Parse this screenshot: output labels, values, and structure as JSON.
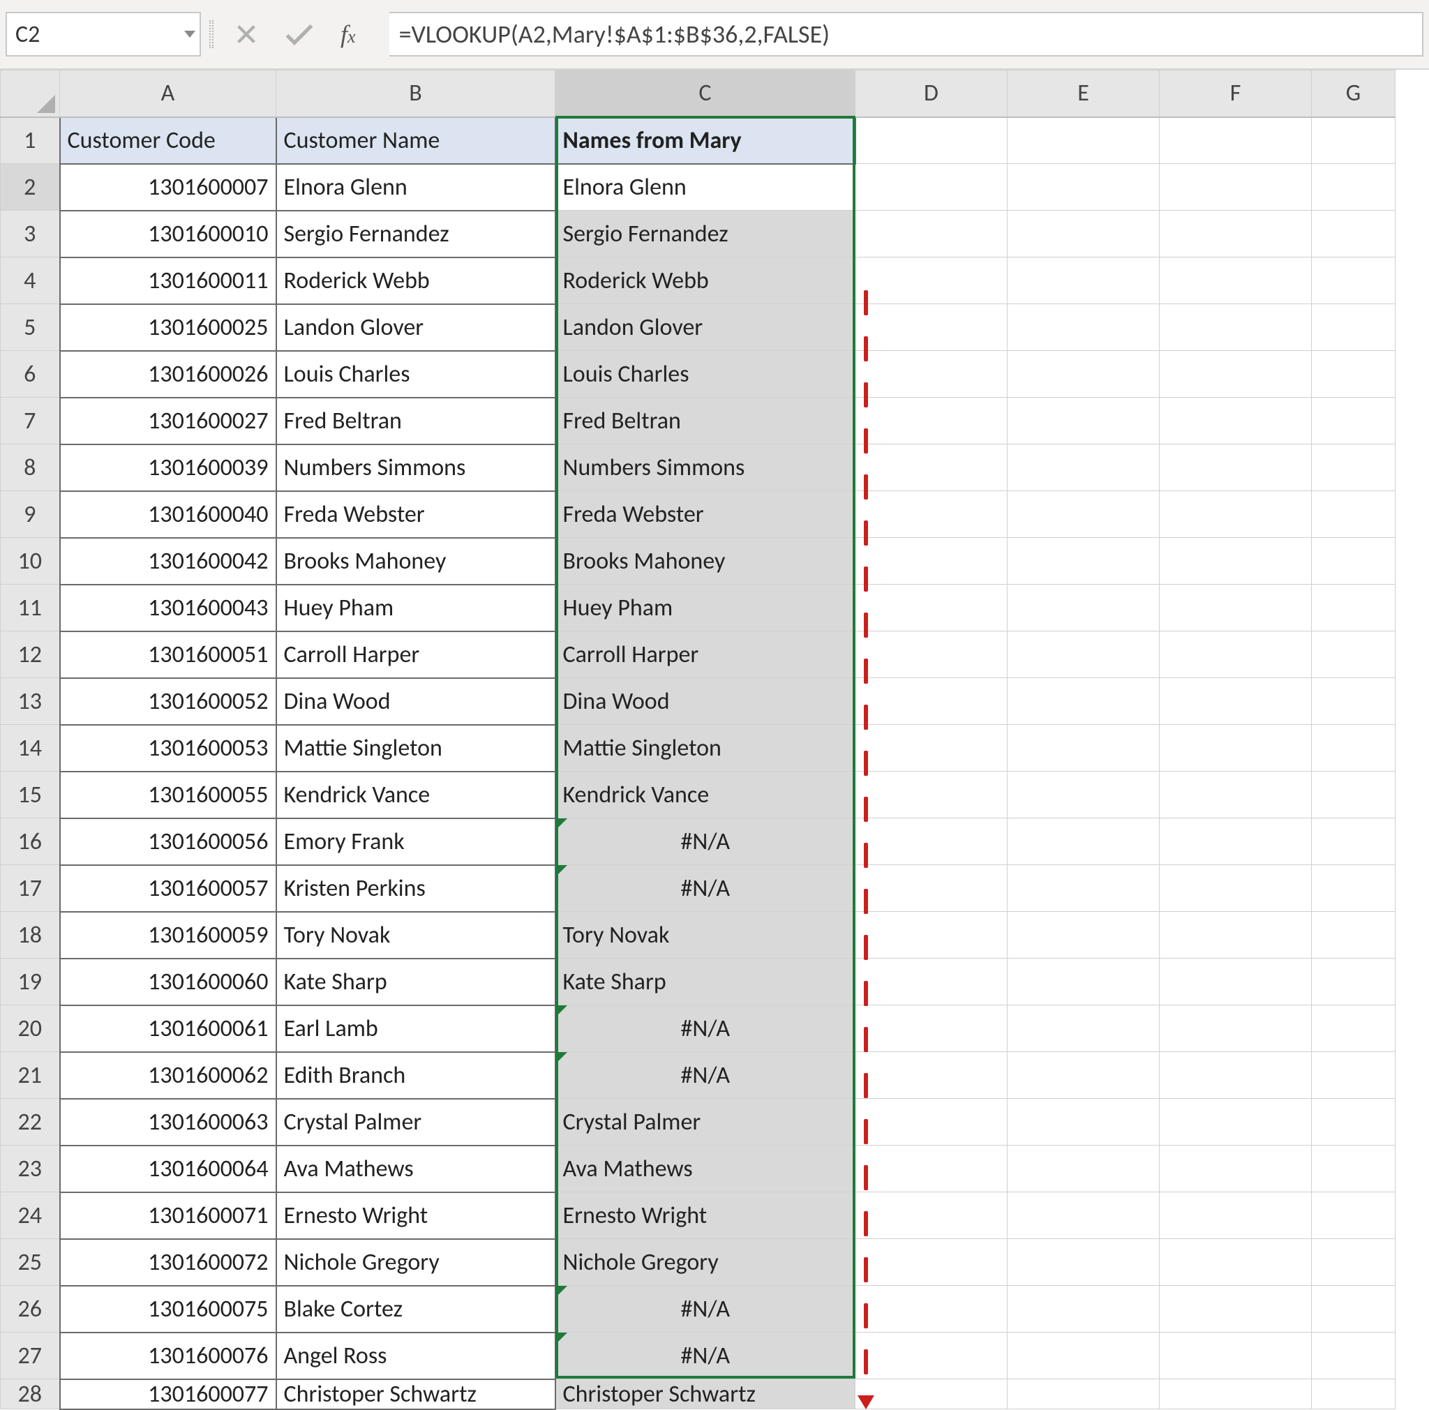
{
  "name_box": "C2",
  "formula": "=VLOOKUP(A2,Mary!$A$1:$B$36,2,FALSE)",
  "columns": [
    "A",
    "B",
    "C",
    "D",
    "E",
    "F",
    "G"
  ],
  "header_row": {
    "A": "Customer Code",
    "B": "Customer Name",
    "C": "Names from Mary"
  },
  "rows": [
    {
      "r": 2,
      "A": "1301600007",
      "B": "Elnora Glenn",
      "C": "Elnora Glenn",
      "err": false
    },
    {
      "r": 3,
      "A": "1301600010",
      "B": "Sergio Fernandez",
      "C": "Sergio Fernandez",
      "err": false
    },
    {
      "r": 4,
      "A": "1301600011",
      "B": "Roderick Webb",
      "C": "Roderick Webb",
      "err": false
    },
    {
      "r": 5,
      "A": "1301600025",
      "B": "Landon Glover",
      "C": "Landon Glover",
      "err": false
    },
    {
      "r": 6,
      "A": "1301600026",
      "B": "Louis Charles",
      "C": "Louis Charles",
      "err": false
    },
    {
      "r": 7,
      "A": "1301600027",
      "B": "Fred Beltran",
      "C": "Fred Beltran",
      "err": false
    },
    {
      "r": 8,
      "A": "1301600039",
      "B": "Numbers Simmons",
      "C": "Numbers Simmons",
      "err": false
    },
    {
      "r": 9,
      "A": "1301600040",
      "B": "Freda Webster",
      "C": "Freda Webster",
      "err": false
    },
    {
      "r": 10,
      "A": "1301600042",
      "B": "Brooks Mahoney",
      "C": "Brooks Mahoney",
      "err": false
    },
    {
      "r": 11,
      "A": "1301600043",
      "B": "Huey Pham",
      "C": "Huey Pham",
      "err": false
    },
    {
      "r": 12,
      "A": "1301600051",
      "B": "Carroll Harper",
      "C": "Carroll Harper",
      "err": false
    },
    {
      "r": 13,
      "A": "1301600052",
      "B": "Dina Wood",
      "C": "Dina Wood",
      "err": false
    },
    {
      "r": 14,
      "A": "1301600053",
      "B": "Mattie Singleton",
      "C": "Mattie Singleton",
      "err": false
    },
    {
      "r": 15,
      "A": "1301600055",
      "B": "Kendrick Vance",
      "C": "Kendrick Vance",
      "err": false
    },
    {
      "r": 16,
      "A": "1301600056",
      "B": "Emory Frank",
      "C": "#N/A",
      "err": true
    },
    {
      "r": 17,
      "A": "1301600057",
      "B": "Kristen Perkins",
      "C": "#N/A",
      "err": true
    },
    {
      "r": 18,
      "A": "1301600059",
      "B": "Tory Novak",
      "C": "Tory Novak",
      "err": false
    },
    {
      "r": 19,
      "A": "1301600060",
      "B": "Kate Sharp",
      "C": "Kate Sharp",
      "err": false
    },
    {
      "r": 20,
      "A": "1301600061",
      "B": "Earl Lamb",
      "C": "#N/A",
      "err": true
    },
    {
      "r": 21,
      "A": "1301600062",
      "B": "Edith Branch",
      "C": "#N/A",
      "err": true
    },
    {
      "r": 22,
      "A": "1301600063",
      "B": "Crystal Palmer",
      "C": "Crystal Palmer",
      "err": false
    },
    {
      "r": 23,
      "A": "1301600064",
      "B": "Ava Mathews",
      "C": "Ava Mathews",
      "err": false
    },
    {
      "r": 24,
      "A": "1301600071",
      "B": "Ernesto Wright",
      "C": "Ernesto Wright",
      "err": false
    },
    {
      "r": 25,
      "A": "1301600072",
      "B": "Nichole Gregory",
      "C": "Nichole Gregory",
      "err": false
    },
    {
      "r": 26,
      "A": "1301600075",
      "B": "Blake Cortez",
      "C": "#N/A",
      "err": true
    },
    {
      "r": 27,
      "A": "1301600076",
      "B": "Angel Ross",
      "C": "#N/A",
      "err": true
    },
    {
      "r": 28,
      "A": "1301600077",
      "B": "Christoper Schwartz",
      "C": "Christoper Schwartz",
      "err": false
    }
  ],
  "na_text": "#N/A"
}
